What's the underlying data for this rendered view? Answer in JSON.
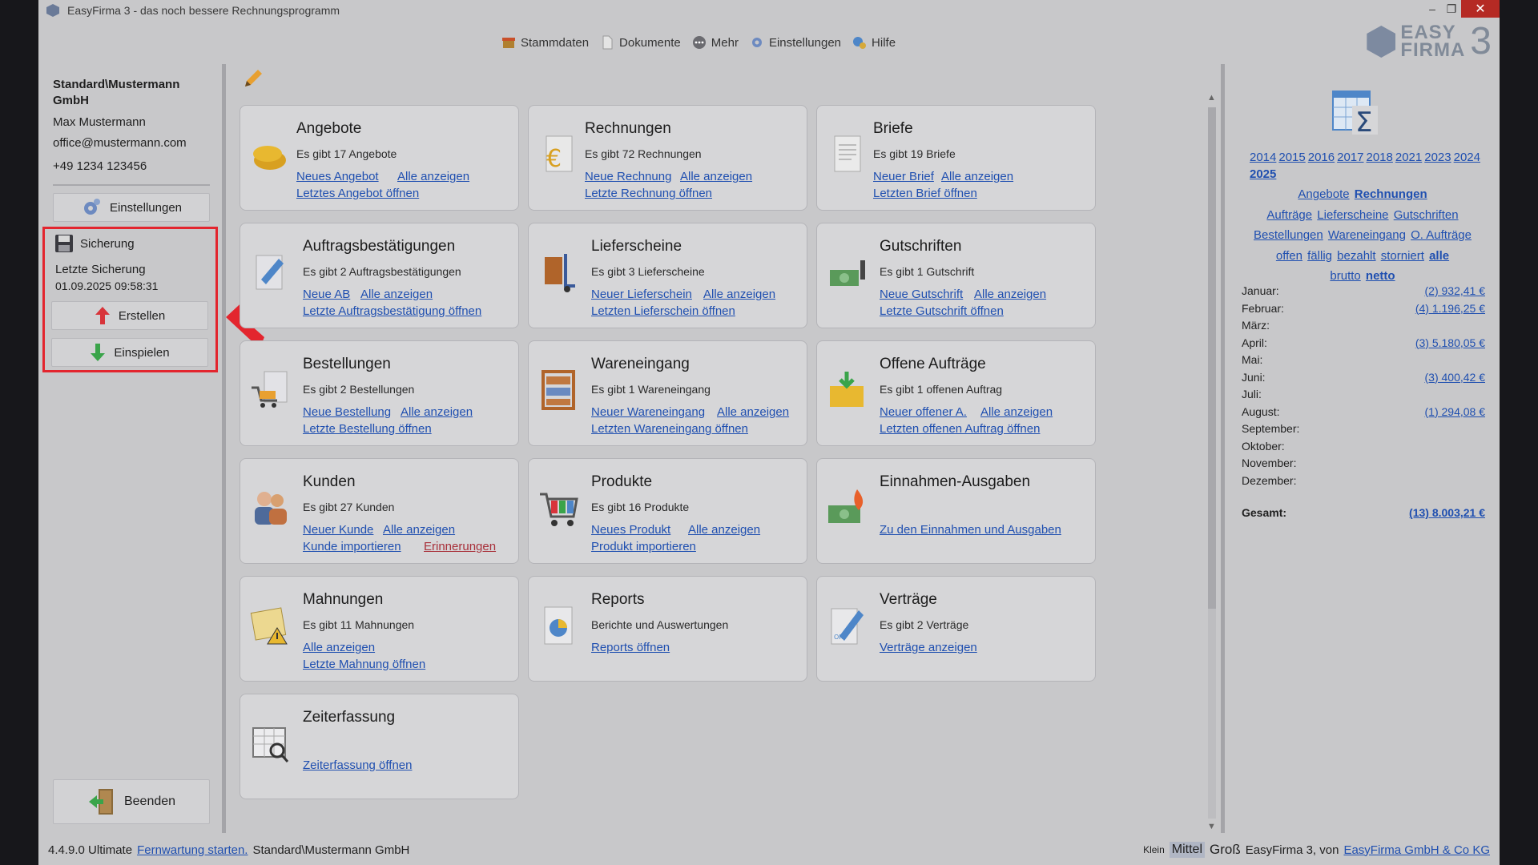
{
  "window": {
    "title": "EasyFirma 3 - das noch bessere Rechnungsprogramm",
    "minimize": "–",
    "restore": "❐",
    "close": "✕"
  },
  "topmenu": {
    "items": [
      {
        "label": "Stammdaten",
        "icon": "store-icon"
      },
      {
        "label": "Dokumente",
        "icon": "document-icon"
      },
      {
        "label": "Mehr",
        "icon": "more-icon"
      },
      {
        "label": "Einstellungen",
        "icon": "gear-icon"
      },
      {
        "label": "Hilfe",
        "icon": "help-icon"
      }
    ]
  },
  "logo": {
    "line1": "EASY",
    "line2": "FIRMA",
    "number": "3"
  },
  "sidebar": {
    "company": "Standard\\Mustermann GmbH",
    "contact_name": "Max Mustermann",
    "email": "office@mustermann.com",
    "phone": "+49 1234 123456",
    "settings_label": "Einstellungen",
    "backup": {
      "title": "Sicherung",
      "last_label": "Letzte Sicherung",
      "last_value": "01.09.2025 09:58:31",
      "create_label": "Erstellen",
      "restore_label": "Einspielen"
    },
    "quit_label": "Beenden"
  },
  "tiles": {
    "angebote": {
      "title": "Angebote",
      "sub": "Es gibt 17 Angebote",
      "l1": "Neues Angebot",
      "l2": "Alle anzeigen",
      "l3": "Letztes Angebot öffnen"
    },
    "rechnungen": {
      "title": "Rechnungen",
      "sub": "Es gibt 72 Rechnungen",
      "l1": "Neue Rechnung",
      "l2": "Alle anzeigen",
      "l3": "Letzte Rechnung öffnen"
    },
    "briefe": {
      "title": "Briefe",
      "sub": "Es gibt 19 Briefe",
      "l1": "Neuer Brief",
      "l2": "Alle anzeigen",
      "l3": "Letzten Brief öffnen"
    },
    "ab": {
      "title": "Auftragsbestätigungen",
      "sub": "Es gibt 2 Auftragsbestätigungen",
      "l1": "Neue AB",
      "l2": "Alle anzeigen",
      "l3": "Letzte Auftragsbestätigung öffnen"
    },
    "lieferscheine": {
      "title": "Lieferscheine",
      "sub": "Es gibt 3 Lieferscheine",
      "l1": "Neuer Lieferschein",
      "l2": "Alle anzeigen",
      "l3": "Letzten Lieferschein öffnen"
    },
    "gutschriften": {
      "title": "Gutschriften",
      "sub": "Es gibt 1 Gutschrift",
      "l1": "Neue Gutschrift",
      "l2": "Alle anzeigen",
      "l3": "Letzte Gutschrift öffnen"
    },
    "bestellungen": {
      "title": "Bestellungen",
      "sub": "Es gibt 2 Bestellungen",
      "l1": "Neue Bestellung",
      "l2": "Alle anzeigen",
      "l3": "Letzte Bestellung öffnen"
    },
    "wareneingang": {
      "title": "Wareneingang",
      "sub": "Es gibt 1 Wareneingang",
      "l1": "Neuer Wareneingang",
      "l2": "Alle anzeigen",
      "l3": "Letzten Wareneingang öffnen"
    },
    "offene": {
      "title": "Offene Aufträge",
      "sub": "Es gibt 1 offenen Auftrag",
      "l1": "Neuer offener A.",
      "l2": "Alle anzeigen",
      "l3": "Letzten offenen Auftrag öffnen"
    },
    "kunden": {
      "title": "Kunden",
      "sub": "Es gibt 27 Kunden",
      "l1": "Neuer Kunde",
      "l2": "Alle anzeigen",
      "l3": "Kunde importieren",
      "l4": "Erinnerungen"
    },
    "produkte": {
      "title": "Produkte",
      "sub": "Es gibt 16 Produkte",
      "l1": "Neues Produkt",
      "l2": "Alle anzeigen",
      "l3": "Produkt importieren"
    },
    "einnahmen": {
      "title": "Einnahmen-Ausgaben",
      "l1": "Zu den Einnahmen und Ausgaben"
    },
    "mahnungen": {
      "title": "Mahnungen",
      "sub": "Es gibt 11 Mahnungen",
      "l1": "Alle anzeigen",
      "l2": "Letzte Mahnung öffnen"
    },
    "reports": {
      "title": "Reports",
      "sub": "Berichte und Auswertungen",
      "l1": "Reports öffnen"
    },
    "vertraege": {
      "title": "Verträge",
      "sub": "Es gibt 2 Verträge",
      "l1": "Verträge anzeigen"
    },
    "zeit": {
      "title": "Zeiterfassung",
      "l1": "Zeiterfassung öffnen"
    }
  },
  "stats": {
    "years": [
      "2014",
      "2015",
      "2016",
      "2017",
      "2018",
      "2021",
      "2023",
      "2024",
      "2025"
    ],
    "active_year": "2025",
    "doc_types": [
      "Angebote",
      "Rechnungen",
      "Aufträge",
      "Lieferscheine",
      "Gutschriften",
      "Bestellungen",
      "Wareneingang",
      "O. Aufträge"
    ],
    "active_doc_type": "Rechnungen",
    "status_filters": [
      "offen",
      "fällig",
      "bezahlt",
      "storniert",
      "alle"
    ],
    "active_status": "alle",
    "amount_modes": [
      "brutto",
      "netto"
    ],
    "active_amount_mode": "netto",
    "months": [
      {
        "label": "Januar:",
        "value": "(2)  932,41 €"
      },
      {
        "label": "Februar:",
        "value": "(4)  1.196,25 €"
      },
      {
        "label": "März:",
        "value": ""
      },
      {
        "label": "April:",
        "value": "(3)  5.180,05 €"
      },
      {
        "label": "Mai:",
        "value": ""
      },
      {
        "label": "Juni:",
        "value": "(3)  400,42 €"
      },
      {
        "label": "Juli:",
        "value": ""
      },
      {
        "label": "August:",
        "value": "(1)  294,08 €"
      },
      {
        "label": "September:",
        "value": ""
      },
      {
        "label": "Oktober:",
        "value": ""
      },
      {
        "label": "November:",
        "value": ""
      },
      {
        "label": "Dezember:",
        "value": ""
      }
    ],
    "total_label": "Gesamt:",
    "total_value": "(13) 8.003,21 €"
  },
  "statusbar": {
    "version": "4.4.9.0 Ultimate",
    "remote_link": "Fernwartung starten.",
    "company": "Standard\\Mustermann GmbH",
    "size_small": "Klein",
    "size_mid": "Mittel",
    "size_big": "Groß",
    "vendor_text": "EasyFirma 3, von",
    "vendor_link": "EasyFirma GmbH & Co KG"
  },
  "colors": {
    "overlay_bg": "#c8c8ca",
    "highlight": "#e3252e",
    "link": "#1f4fb0"
  }
}
